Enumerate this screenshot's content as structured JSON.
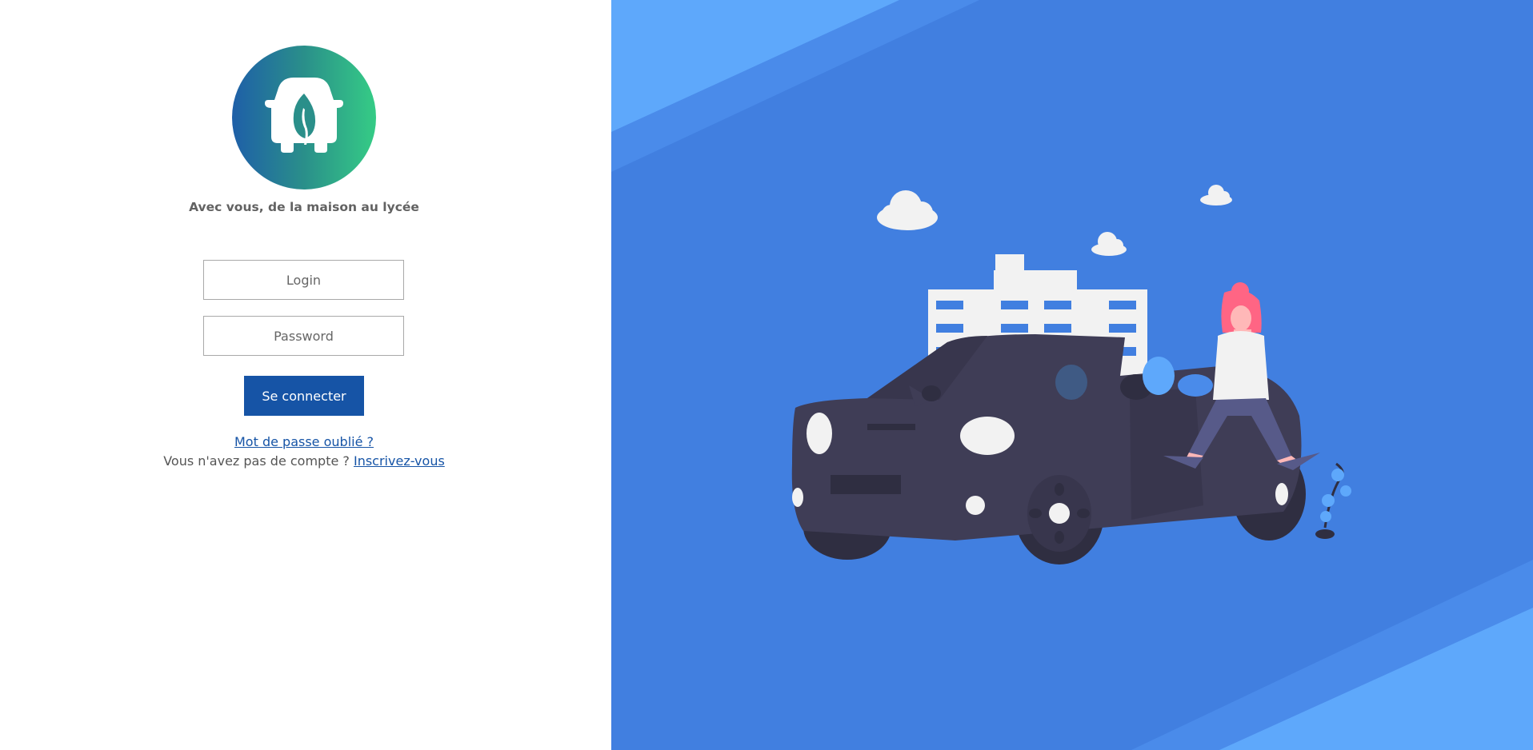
{
  "branding": {
    "tagline": "Avec vous, de la maison au lycée",
    "logo_icon": "car-leaf-icon",
    "gradient_colors": [
      "#1e5fa8",
      "#35cc86"
    ]
  },
  "form": {
    "login_placeholder": "Login",
    "password_placeholder": "Password",
    "submit_label": "Se connecter"
  },
  "links": {
    "forgot_password": "Mot de passe oublié ?",
    "no_account": "Vous n'avez pas de compte ?",
    "signup": "Inscrivez-vous"
  },
  "colors": {
    "primary": "#1654a6",
    "panel_blue": "#417fe0",
    "panel_light_blue": "#5ea8fb"
  }
}
